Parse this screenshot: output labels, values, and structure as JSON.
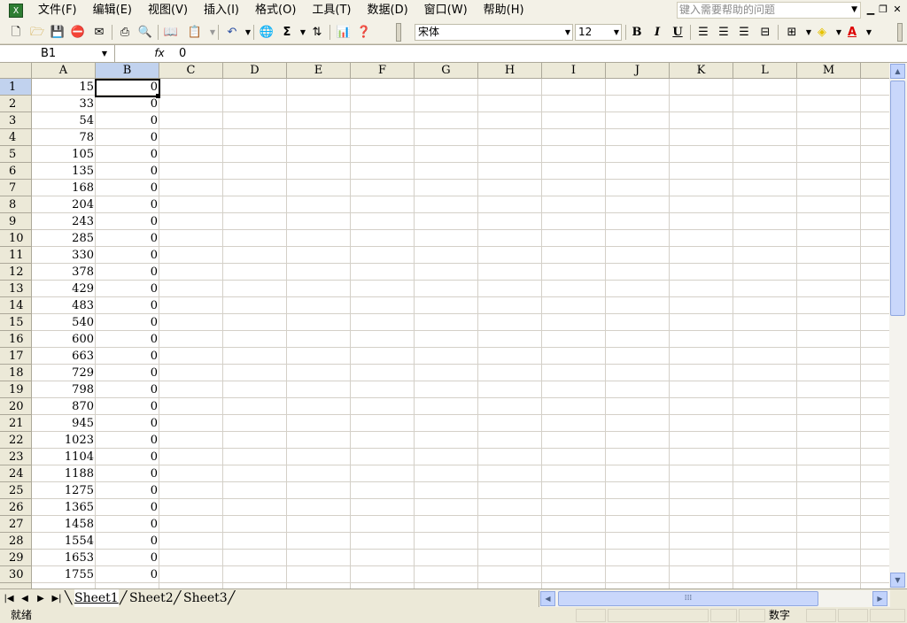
{
  "menu": [
    "文件(F)",
    "编辑(E)",
    "视图(V)",
    "插入(I)",
    "格式(O)",
    "工具(T)",
    "数据(D)",
    "窗口(W)",
    "帮助(H)"
  ],
  "help_placeholder": "键入需要帮助的问题",
  "toolbar": {
    "font": "宋体",
    "size": "12",
    "bold": "B",
    "italic": "I",
    "underline": "U",
    "sum": "Σ",
    "font_color_letter": "A"
  },
  "name_box": "B1",
  "formula_label": "fx",
  "formula_value": "0",
  "columns": [
    "A",
    "B",
    "C",
    "D",
    "E",
    "F",
    "G",
    "H",
    "I",
    "J",
    "K",
    "L",
    "M"
  ],
  "row_numbers": [
    "1",
    "2",
    "3",
    "4",
    "5",
    "6",
    "7",
    "8",
    "9",
    "10",
    "11",
    "12",
    "13",
    "14",
    "15",
    "16",
    "17",
    "18",
    "19",
    "20",
    "21",
    "22",
    "23",
    "24",
    "25",
    "26",
    "27",
    "28",
    "29",
    "30"
  ],
  "col_a": [
    "15",
    "33",
    "54",
    "78",
    "105",
    "135",
    "168",
    "204",
    "243",
    "285",
    "330",
    "378",
    "429",
    "483",
    "540",
    "600",
    "663",
    "729",
    "798",
    "870",
    "945",
    "1023",
    "1104",
    "1188",
    "1275",
    "1365",
    "1458",
    "1554",
    "1653",
    "1755"
  ],
  "col_b": [
    "0",
    "0",
    "0",
    "0",
    "0",
    "0",
    "0",
    "0",
    "0",
    "0",
    "0",
    "0",
    "0",
    "0",
    "0",
    "0",
    "0",
    "0",
    "0",
    "0",
    "0",
    "0",
    "0",
    "0",
    "0",
    "0",
    "0",
    "0",
    "0",
    "0"
  ],
  "sheets": [
    "Sheet1",
    "Sheet2",
    "Sheet3"
  ],
  "status": {
    "ready": "就绪",
    "mode": "数字"
  }
}
